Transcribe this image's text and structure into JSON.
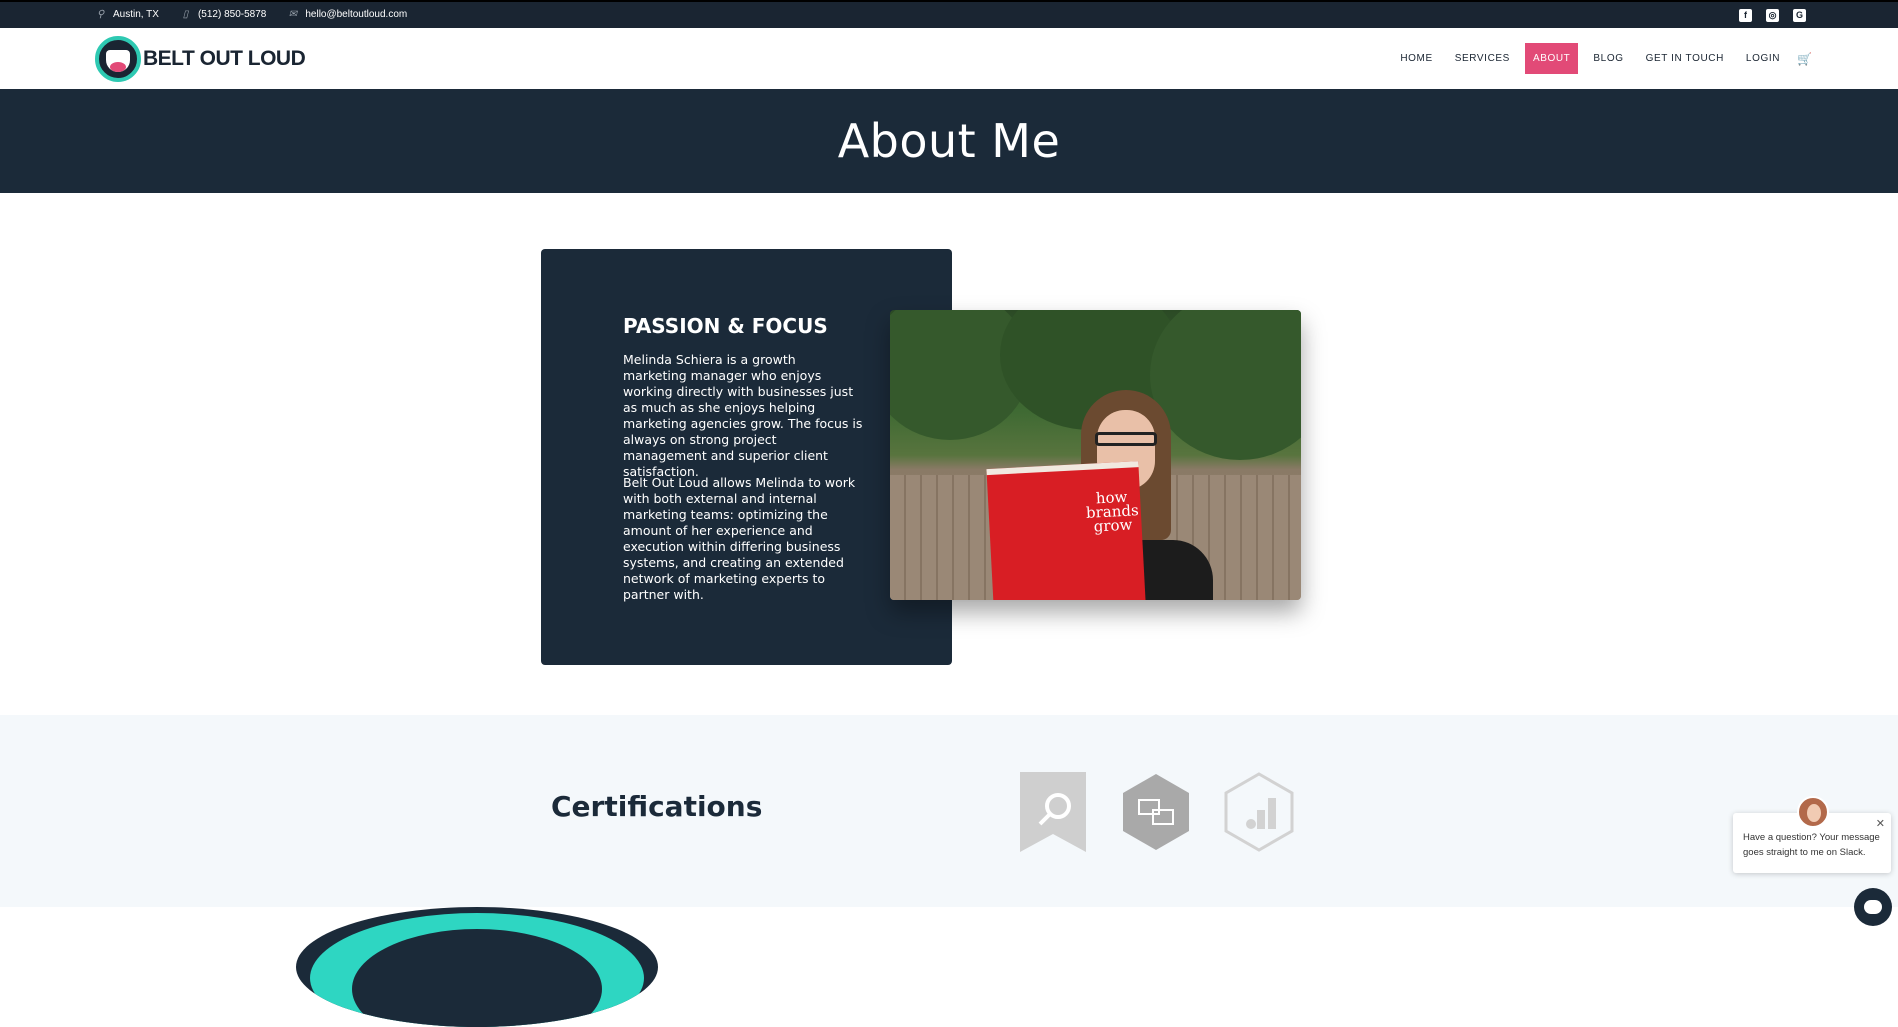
{
  "topbar": {
    "location": "Austin, TX",
    "phone": "(512) 850-5878",
    "email": "hello@beltoutloud.com",
    "social": [
      "facebook-icon",
      "instagram-icon",
      "google-plus-icon"
    ]
  },
  "brand": {
    "name": "BELT OUT LOUD"
  },
  "nav": {
    "items": [
      "HOME",
      "SERVICES",
      "ABOUT",
      "BLOG",
      "GET IN TOUCH",
      "LOGIN"
    ],
    "active": "ABOUT"
  },
  "hero": {
    "title": "About Me"
  },
  "about": {
    "heading": "PASSION & FOCUS",
    "p1": "Melinda Schiera is a growth marketing manager who enjoys working directly with businesses just as much as she enjoys helping marketing agencies grow. The focus is always on strong project management and superior client satisfaction.",
    "p2": "Belt Out Loud allows Melinda to work with both external and internal marketing teams: optimizing the amount of her experience and execution within differing business systems, and creating an extended network of marketing experts to partner with.",
    "photo_book_text": "how brands grow"
  },
  "certifications": {
    "heading": "Certifications",
    "badges": [
      "search-ads-badge-icon",
      "display-ads-badge-icon",
      "analytics-badge-icon"
    ]
  },
  "chat": {
    "message": "Have a question? Your message goes straight to me on Slack.",
    "close": "✕"
  },
  "colors": {
    "accent": "#e24a77",
    "dark": "#1b2a39",
    "teal": "#2ec9b2"
  }
}
